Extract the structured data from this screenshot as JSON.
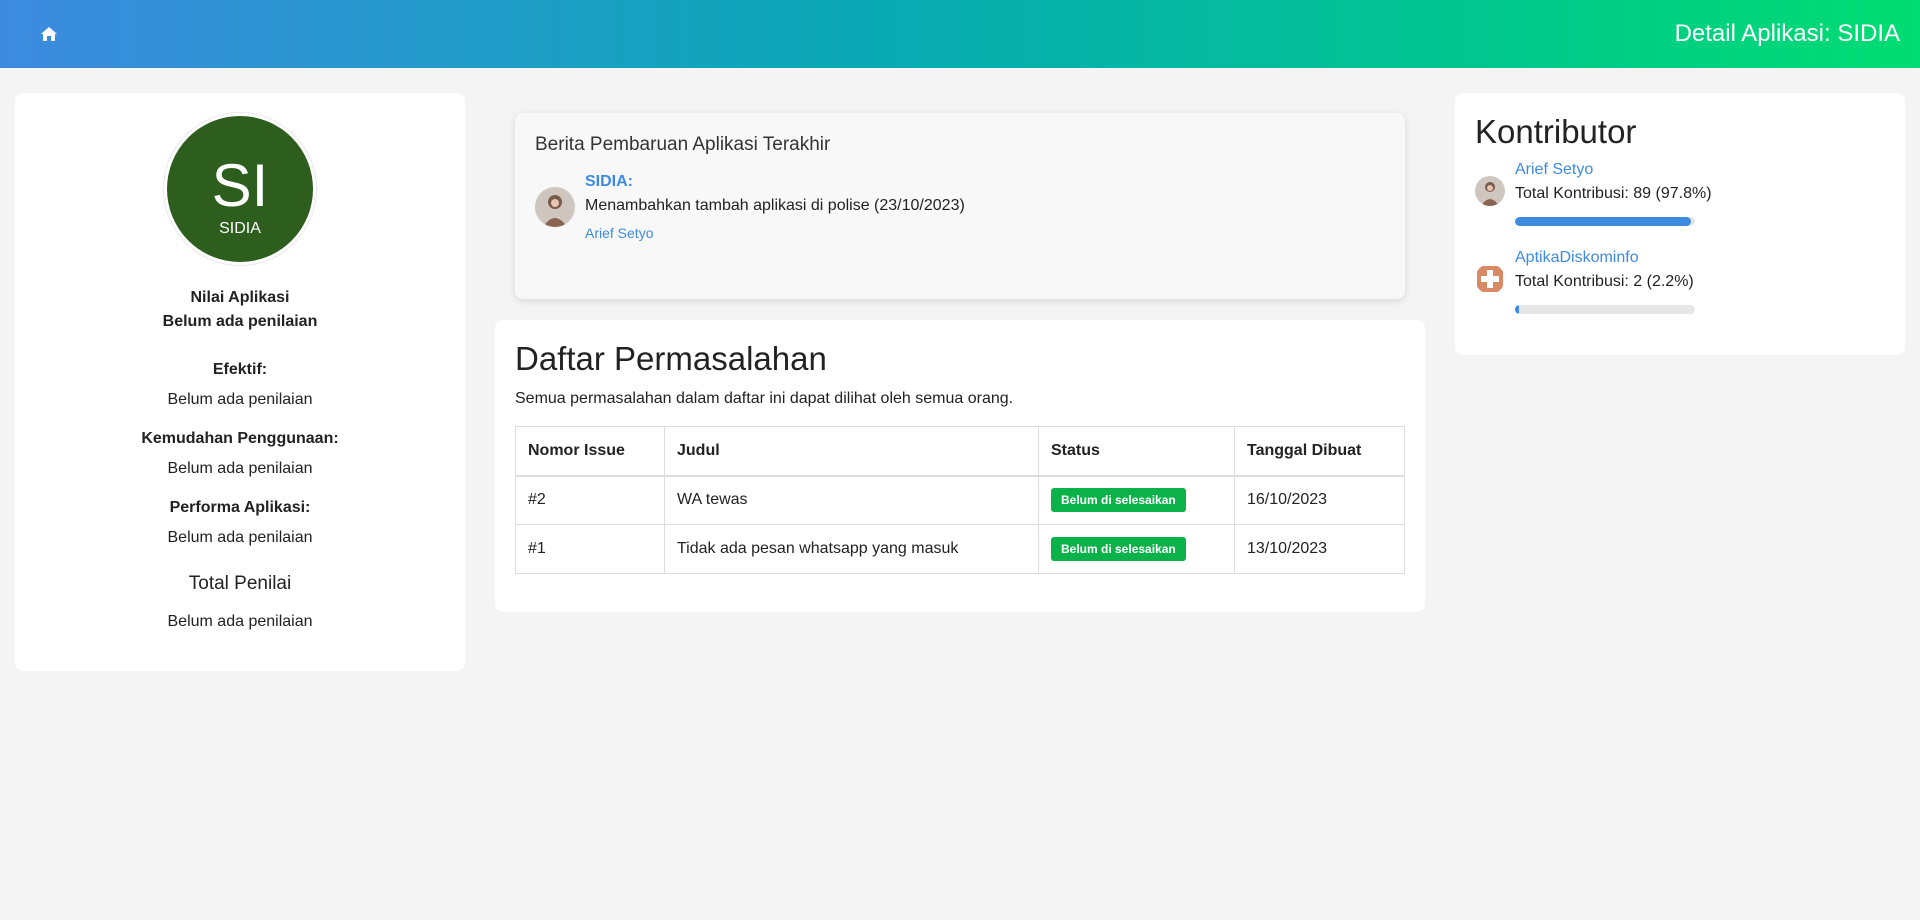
{
  "header": {
    "home_icon": "home-icon",
    "title": "Detail Aplikasi: SIDIA"
  },
  "app": {
    "initials": "SI",
    "name": "SIDIA",
    "avatar_color": "#2d5e1e"
  },
  "rating": {
    "label": "Nilai Aplikasi",
    "value": "Belum ada penilaian",
    "efektif_label": "Efektif:",
    "efektif_value": "Belum ada penilaian",
    "kemudahan_label": "Kemudahan Penggunaan:",
    "kemudahan_value": "Belum ada penilaian",
    "performa_label": "Performa Aplikasi:",
    "performa_value": "Belum ada penilaian",
    "total_label": "Total Penilai",
    "total_value": "Belum ada penilaian"
  },
  "news": {
    "heading": "Berita Pembaruan Aplikasi Terakhir",
    "app_label": "SIDIA:",
    "text": "Menambahkan tambah aplikasi di polise (23/10/2023)",
    "author": "Arief Setyo"
  },
  "issues": {
    "title": "Daftar Permasalahan",
    "description": "Semua permasalahan dalam daftar ini dapat dilihat oleh semua orang.",
    "columns": [
      "Nomor Issue",
      "Judul",
      "Status",
      "Tanggal Dibuat"
    ],
    "rows": [
      {
        "number": "#2",
        "title": "WA tewas",
        "status": "Belum di selesaikan",
        "date": "16/10/2023"
      },
      {
        "number": "#1",
        "title": "Tidak ada pesan whatsapp yang masuk",
        "status": "Belum di selesaikan",
        "date": "13/10/2023"
      }
    ],
    "status_color": "#0bb24a"
  },
  "contributors": {
    "title": "Kontributor",
    "items": [
      {
        "name": "Arief Setyo",
        "total": "Total Kontribusi: 89 (97.8%)",
        "progress": 0.978
      },
      {
        "name": "AptikaDiskominfo",
        "total": "Total Kontribusi: 2 (2.2%)",
        "progress": 0.022
      }
    ]
  }
}
